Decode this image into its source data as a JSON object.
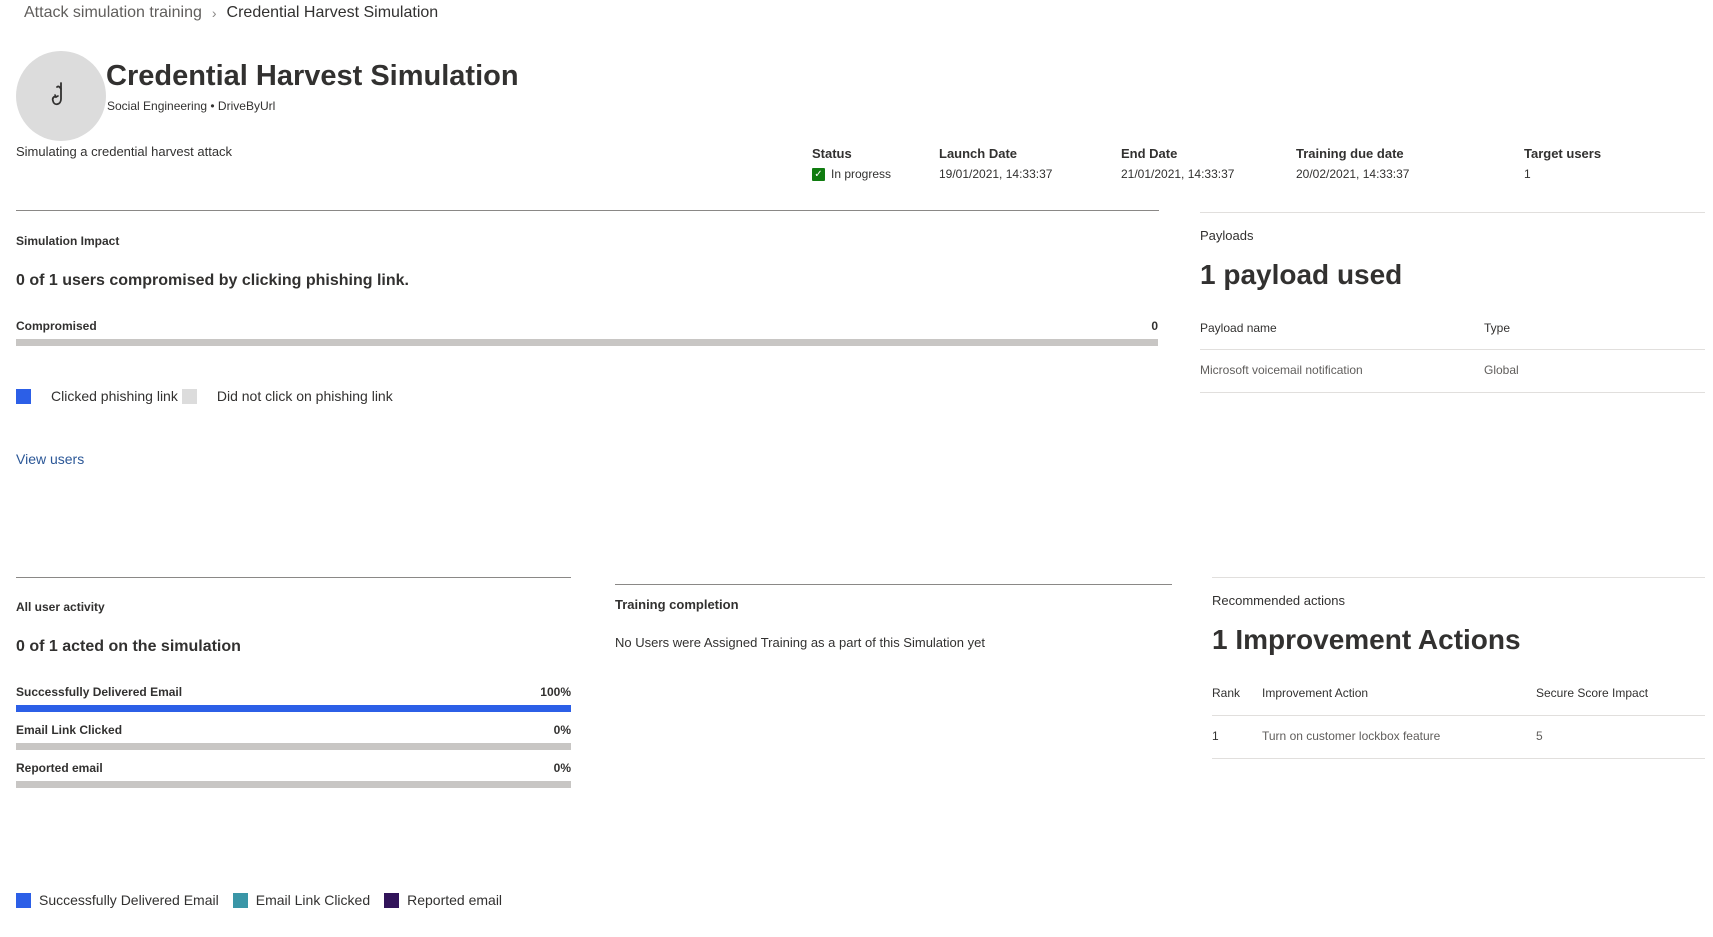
{
  "breadcrumb": {
    "parent": "Attack simulation training",
    "current": "Credential Harvest Simulation"
  },
  "header": {
    "icon": "hook-icon",
    "title": "Credential Harvest Simulation",
    "subtitle": "Social Engineering • DriveByUrl",
    "description": "Simulating a credential harvest attack"
  },
  "meta": {
    "status_label": "Status",
    "status_value": "In progress",
    "launch_label": "Launch Date",
    "launch_value": "19/01/2021, 14:33:37",
    "end_label": "End Date",
    "end_value": "21/01/2021, 14:33:37",
    "due_label": "Training due date",
    "due_value": "20/02/2021, 14:33:37",
    "target_label": "Target users",
    "target_value": "1"
  },
  "impact": {
    "label": "Simulation Impact",
    "heading": "0 of 1 users compromised by clicking phishing link.",
    "bar_label": "Compromised",
    "bar_value": "0",
    "bar_fraction": 0,
    "legend_clicked": "Clicked phishing link",
    "legend_not_clicked": "Did not click on phishing link",
    "view_users": "View users"
  },
  "payloads": {
    "label": "Payloads",
    "heading": "1 payload used",
    "col_name": "Payload name",
    "col_type": "Type",
    "rows": [
      {
        "name": "Microsoft voicemail notification",
        "type": "Global"
      }
    ]
  },
  "activity": {
    "label": "All user activity",
    "heading": "0 of 1 acted on the simulation",
    "bars": [
      {
        "label": "Successfully Delivered Email",
        "value": "100%",
        "fraction": 1.0
      },
      {
        "label": "Email Link Clicked",
        "value": "0%",
        "fraction": 0
      },
      {
        "label": "Reported email",
        "value": "0%",
        "fraction": 0
      }
    ],
    "legend": [
      {
        "label": "Successfully Delivered Email",
        "color": "#2c5fe7"
      },
      {
        "label": "Email Link Clicked",
        "color": "#3a96a7"
      },
      {
        "label": "Reported email",
        "color": "#32145a"
      }
    ]
  },
  "training": {
    "label": "Training completion",
    "text": "No Users were Assigned Training as a part of this Simulation yet"
  },
  "recommended": {
    "label": "Recommended actions",
    "heading": "1 Improvement Actions",
    "col_rank": "Rank",
    "col_action": "Improvement Action",
    "col_impact": "Secure Score Impact",
    "rows": [
      {
        "rank": "1",
        "action": "Turn on customer lockbox feature",
        "impact": "5"
      }
    ]
  },
  "colors": {
    "accent_blue": "#2c5fe7",
    "not_clicked_gray": "#dcdcdc",
    "status_green": "#107c10"
  }
}
